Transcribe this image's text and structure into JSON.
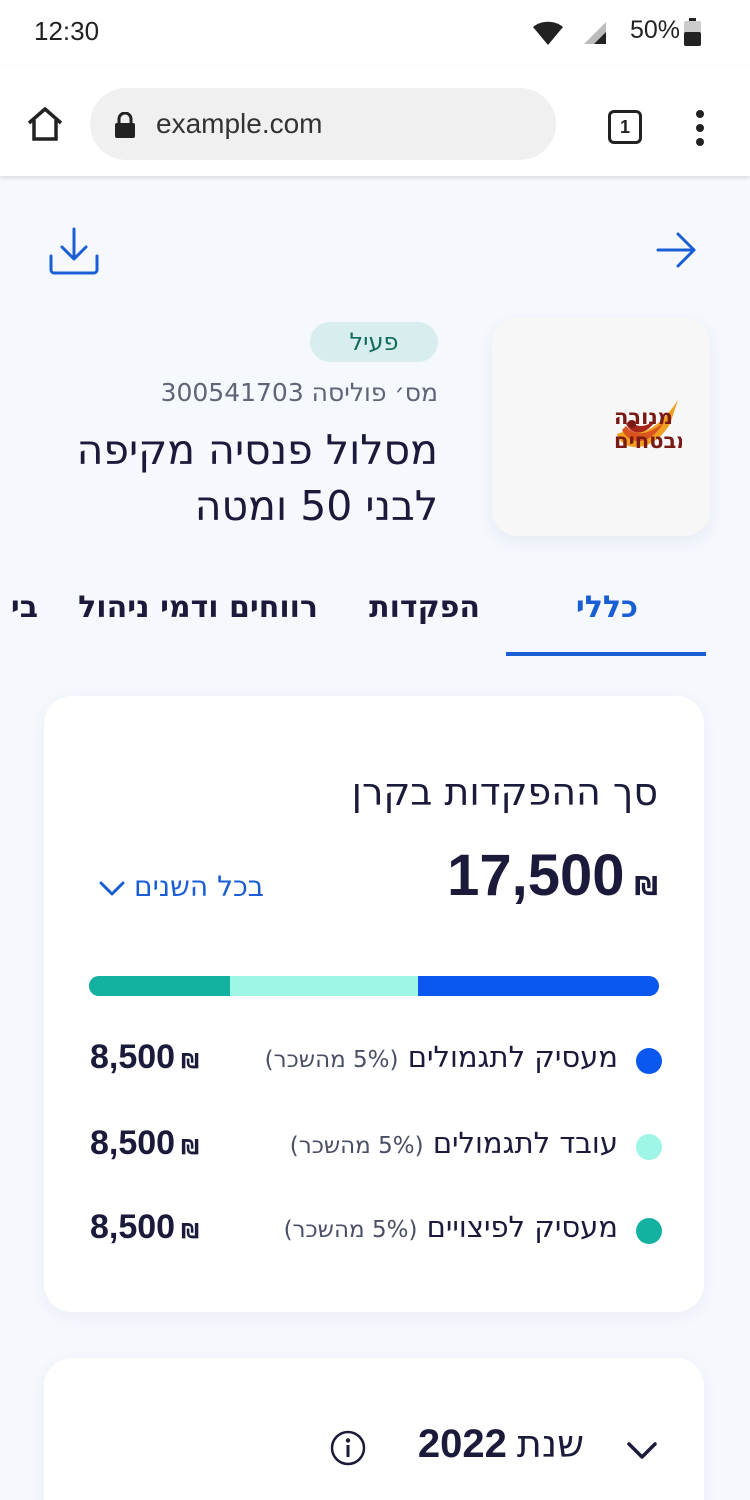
{
  "status_bar": {
    "time": "12:30",
    "battery": "50%"
  },
  "browser": {
    "url": "example.com",
    "tab_count": "1"
  },
  "policy": {
    "company": "מנורה מבטחים",
    "status": "פעיל",
    "number_label": "מס׳ פוליסה 300541703",
    "title": "מסלול פנסיה מקיפה לבני 50 ומטה"
  },
  "tabs": [
    {
      "label": "כללי",
      "active": true
    },
    {
      "label": "הפקדות",
      "active": false
    },
    {
      "label": "רווחים ודמי ניהול",
      "active": false
    },
    {
      "label": "בי",
      "active": false
    }
  ],
  "deposits": {
    "title": "סך ההפקדות בקרן",
    "total": "17,500",
    "currency": "₪",
    "period_select": "בכל השנים",
    "bar_fractions": [
      0.247,
      0.33,
      0.423
    ],
    "items": [
      {
        "label": "מעסיק לתגמולים",
        "note": "(5% מהשכר)",
        "value": "8,500",
        "currency": "₪",
        "color": "#0a58f0"
      },
      {
        "label": "עובד לתגמולים",
        "note": "(5% מהשכר)",
        "value": "8,500",
        "currency": "₪",
        "color": "#9ff5e6"
      },
      {
        "label": "מעסיק לפיצויים",
        "note": "(5% מהשכר)",
        "value": "8,500",
        "currency": "₪",
        "color": "#13b1a0"
      }
    ]
  },
  "year_section": {
    "word": "שנת",
    "year": "2022"
  },
  "colors": {
    "accent": "#1a5ed6",
    "teal": "#13b1a0",
    "mint": "#9ff5e6",
    "blue": "#0a58f0"
  }
}
